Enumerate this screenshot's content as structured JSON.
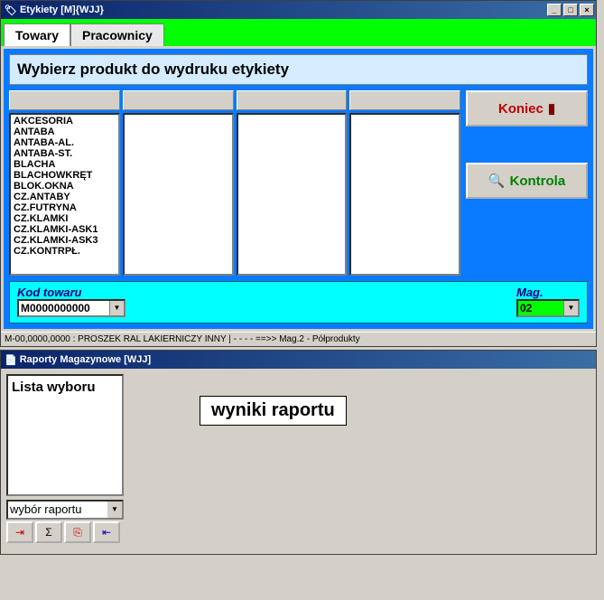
{
  "win1": {
    "title": "Etykiety [M]{WJJ}",
    "tabs": {
      "towary": "Towary",
      "pracownicy": "Pracownicy"
    },
    "instruction": "Wybierz produkt do wydruku etykiety",
    "buttons": {
      "koniec": "Koniec",
      "kontrola": "Kontrola"
    },
    "list1": [
      "AKCESORIA",
      "ANTABA",
      "ANTABA-AL.",
      "ANTABA-ST.",
      "BLACHA",
      "BLACHOWKRĘT",
      "BLOK.OKNA",
      "CZ.ANTABY",
      "CZ.FUTRYNA",
      "CZ.KLAMKI",
      "CZ.KLAMKI-ASK1",
      "CZ.KLAMKI-ASK3",
      "CZ.KONTRPŁ."
    ],
    "kod_label": "Kod towaru",
    "kod_value": "M0000000000",
    "mag_label": "Mag.",
    "mag_value": "02",
    "status": "M-00,0000,0000 : PROSZEK RAL LAKIERNICZY INNY | - - - -  ==>>  Mag.2 - Półprodukty"
  },
  "win2": {
    "title": "Raporty Magazynowe [WJJ]",
    "panel_header": "Lista wyboru",
    "result_label": "wyniki raportu",
    "combo_text": "wybór raportu",
    "toolbar_icons": [
      "add-row-icon",
      "sigma-icon",
      "export-icon",
      "add-col-icon"
    ]
  }
}
